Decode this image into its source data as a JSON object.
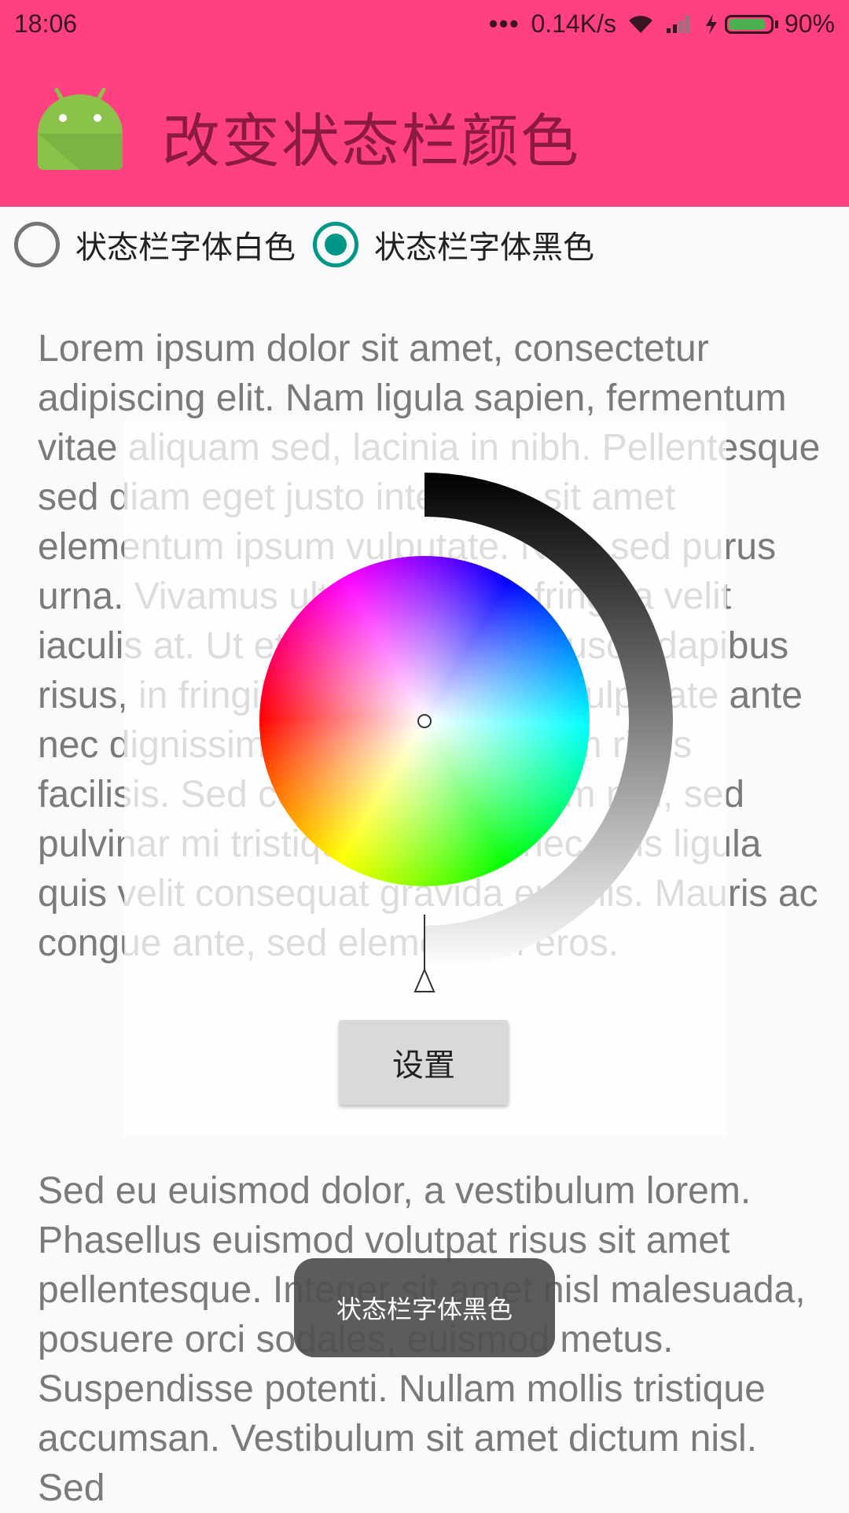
{
  "status_bar": {
    "time": "18:06",
    "dots": "•••",
    "speed": "0.14K/s",
    "battery": "90%",
    "battery_level": 0.9,
    "icons": [
      "wifi-icon",
      "signal-icon",
      "charging-icon",
      "battery-icon"
    ]
  },
  "toolbar": {
    "title": "改变状态栏颜色",
    "icon": "android-icon",
    "background_color": "#ff4081"
  },
  "radio_group": {
    "options": [
      {
        "label": "状态栏字体白色",
        "checked": false
      },
      {
        "label": "状态栏字体黑色",
        "checked": true
      }
    ],
    "accent_color": "#009688"
  },
  "content": {
    "paragraphs": [
      "Lorem ipsum dolor sit amet, consectetur adipiscing elit. Nam ligula sapien, fermentum vitae aliquam sed, lacinia in nibh. Pellentesque sed diam eget justo interdum, sit amet elementum ipsum vulputate. Nam sed purus urna. Vivamus ultrices lorem, fringilla velit iaculis at. Ut et posuere justo. Fusce dapibus risus, in fringilla diam. Vivamus vulputate ante nec dignissim, consectetur rutrum risus facilisis. Sed consectetur aliquam nisl, sed pulvinar mi tristique vitae. Donec quis ligula quis velit consequat gravida eu felis. Mauris ac congue ante, sed elementum eros.",
      "Sed eu euismod dolor, a vestibulum lorem. Phasellus euismod volutpat risus sit amet pellentesque. Integer sit amet nisl malesuada, posuere orci sodales, euismod metus. Suspendisse potenti. Nullam mollis tristique accumsan. Vestibulum sit amet dictum nisl. Sed"
    ]
  },
  "color_picker": {
    "wheel": "hue-saturation-wheel",
    "brightness_bar": "black-to-white-arc",
    "button_label": "设置"
  },
  "toast": {
    "message": "状态栏字体黑色"
  }
}
